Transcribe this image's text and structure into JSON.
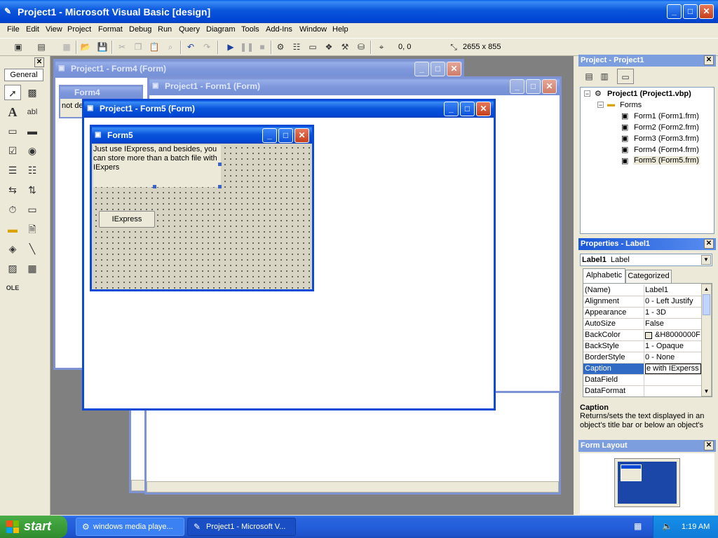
{
  "app": {
    "title": "Project1 - Microsoft Visual Basic [design]"
  },
  "menu": [
    "File",
    "Edit",
    "View",
    "Project",
    "Format",
    "Debug",
    "Run",
    "Query",
    "Diagram",
    "Tools",
    "Add-Ins",
    "Window",
    "Help"
  ],
  "toolbar": {
    "position": "0, 0",
    "size": "2655 x 855"
  },
  "toolbox": {
    "tab": "General"
  },
  "windows": {
    "form4_designer": {
      "title": "Project1 - Form4 (Form)"
    },
    "form4_inner": {
      "title": "Form4",
      "label_text": "not de"
    },
    "form1_designer": {
      "title": "Project1 - Form1 (Form)"
    },
    "form5_designer": {
      "title": "Project1 - Form5 (Form)"
    },
    "form5": {
      "title": "Form5",
      "label_text": "Just use IExpress, and besides, you can store more than a batch file with IExpers",
      "button_text": "IExpress"
    }
  },
  "project_explorer": {
    "title": "Project - Project1",
    "root": "Project1 (Project1.vbp)",
    "folder": "Forms",
    "items": [
      "Form1 (Form1.frm)",
      "Form2 (Form2.frm)",
      "Form3 (Form3.frm)",
      "Form4 (Form4.frm)",
      "Form5 (Form5.frm)"
    ]
  },
  "properties": {
    "title": "Properties - Label1",
    "object_name": "Label1",
    "object_type": "Label",
    "tabs": [
      "Alphabetic",
      "Categorized"
    ],
    "rows": [
      {
        "name": "(Name)",
        "value": "Label1"
      },
      {
        "name": "Alignment",
        "value": "0 - Left Justify"
      },
      {
        "name": "Appearance",
        "value": "1 - 3D"
      },
      {
        "name": "AutoSize",
        "value": "False"
      },
      {
        "name": "BackColor",
        "value": "&H8000000F"
      },
      {
        "name": "BackStyle",
        "value": "1 - Opaque"
      },
      {
        "name": "BorderStyle",
        "value": "0 - None"
      },
      {
        "name": "Caption",
        "value": "e with IExperss"
      },
      {
        "name": "DataField",
        "value": ""
      },
      {
        "name": "DataFormat",
        "value": ""
      }
    ],
    "selected_row": "Caption",
    "description_title": "Caption",
    "description_text": "Returns/sets the text displayed in an object's title bar or below an object's"
  },
  "form_layout": {
    "title": "Form Layout"
  },
  "taskbar": {
    "start": "start",
    "buttons": [
      "windows media playe...",
      "Project1 - Microsoft V..."
    ],
    "clock": "1:19 AM"
  }
}
